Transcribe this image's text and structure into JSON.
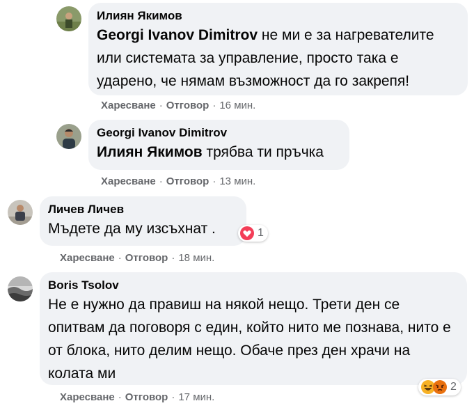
{
  "comments": [
    {
      "author": "Илиян Якимов",
      "mention": "Georgi Ivanov Dimitrov",
      "text": " не ми е за нагревателите или системата за управление, просто така е ударено, че нямам възможност да го закрепя!",
      "like": "Харесване",
      "reply": "Отговор",
      "time": "16 мин."
    },
    {
      "author": "Georgi Ivanov Dimitrov",
      "mention": "Илиян Якимов",
      "text": " трябва ти пръчка",
      "like": "Харесване",
      "reply": "Отговор",
      "time": "13 мин."
    },
    {
      "author": "Личев Личев",
      "text": "Мъдете да му изсъхнат .",
      "like": "Харесване",
      "reply": "Отговор",
      "time": "18 мин.",
      "reaction_count": "1",
      "reaction_icons": [
        "heart-icon"
      ]
    },
    {
      "author": "Boris Tsolov",
      "text": "Не е нужно да правиш на някой нещо. Трети ден се опитвам да поговоря с един, който нито ме познава, нито е от блока, нито делим нещо. Обаче през ден храчи на колата ми",
      "like": "Харесване",
      "reply": "Отговор",
      "time": "17 мин.",
      "reaction_count": "2",
      "reaction_icons": [
        "laughing-emoji-icon",
        "angry-emoji-icon"
      ]
    }
  ],
  "separator": "·",
  "colors": {
    "bubble": "#f0f2f5",
    "meta_text": "#65676b",
    "text": "#050505",
    "heart": "#f33e58",
    "emoji_yellow": "#f7b125",
    "angry": "#e9710f"
  }
}
